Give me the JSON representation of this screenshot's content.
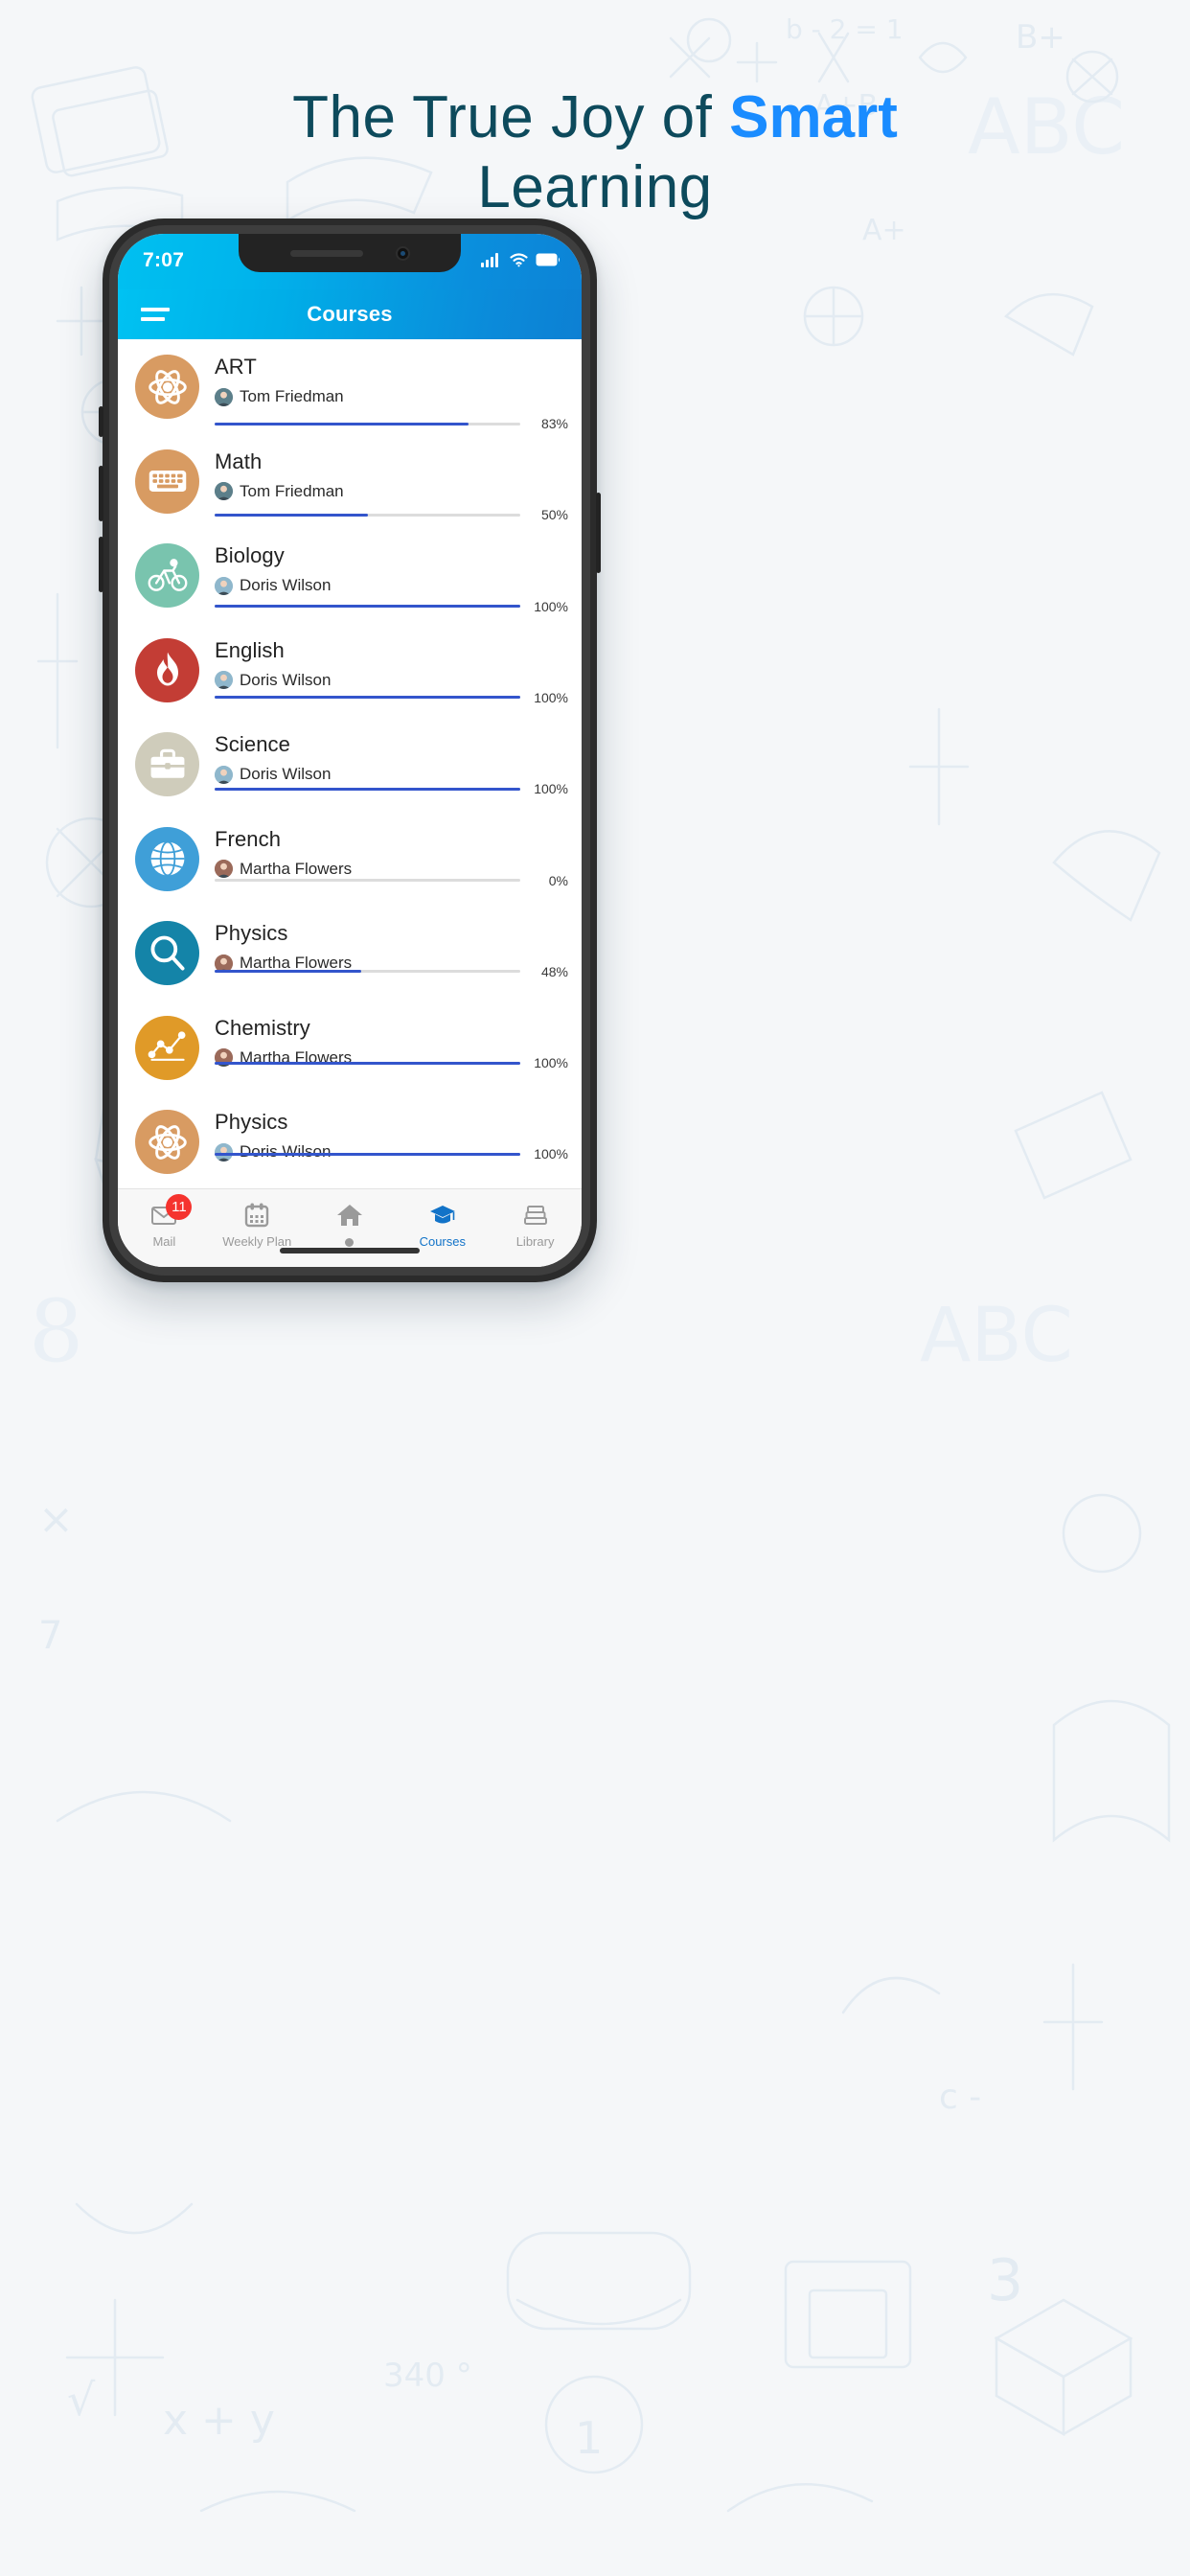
{
  "hero": {
    "line1_pre": "The True Joy of ",
    "line1_accent": "Smart",
    "line2": "Learning",
    "accent_color": "#1a8cff",
    "text_color": "#0d4a5c"
  },
  "status_bar": {
    "time": "7:07",
    "signal_icon": "cellular-signal-icon",
    "wifi_icon": "wifi-icon",
    "battery_icon": "battery-icon"
  },
  "app_bar": {
    "menu_icon": "hamburger-menu-icon",
    "title": "Courses",
    "gradient_from": "#00c2f2",
    "gradient_to": "#0d80d3"
  },
  "courses": [
    {
      "name": "ART",
      "teacher": "Tom Friedman",
      "progress": 83,
      "progress_label": "83%",
      "icon": "atom-icon",
      "avatar_color": "#d89b62",
      "teacher_color": "#5c7f8a"
    },
    {
      "name": "Math",
      "teacher": "Tom Friedman",
      "progress": 50,
      "progress_label": "50%",
      "icon": "keyboard-icon",
      "avatar_color": "#d89b62",
      "teacher_color": "#5c7f8a"
    },
    {
      "name": "Biology",
      "teacher": "Doris Wilson",
      "progress": 100,
      "progress_label": "100%",
      "icon": "bicycle-icon",
      "avatar_color": "#79c4ae",
      "teacher_color": "#8fb7cc"
    },
    {
      "name": "English",
      "teacher": "Doris Wilson",
      "progress": 100,
      "progress_label": "100%",
      "icon": "flame-icon",
      "avatar_color": "#c33d35",
      "teacher_color": "#8fb7cc"
    },
    {
      "name": "Science",
      "teacher": "Doris Wilson",
      "progress": 100,
      "progress_label": "100%",
      "icon": "briefcase-icon",
      "avatar_color": "#cfccbb",
      "teacher_color": "#8fb7cc"
    },
    {
      "name": "French",
      "teacher": "Martha Flowers",
      "progress": 0,
      "progress_label": "0%",
      "icon": "globe-icon",
      "avatar_color": "#3f9fd8",
      "teacher_color": "#9b6a5a"
    },
    {
      "name": "Physics",
      "teacher": "Martha Flowers",
      "progress": 48,
      "progress_label": "48%",
      "icon": "magnifier-icon",
      "avatar_color": "#1484a8",
      "teacher_color": "#9b6a5a"
    },
    {
      "name": "Chemistry",
      "teacher": "Martha Flowers",
      "progress": 100,
      "progress_label": "100%",
      "icon": "line-chart-icon",
      "avatar_color": "#e09a28",
      "teacher_color": "#9b6a5a"
    },
    {
      "name": "Physics",
      "teacher": "Doris Wilson",
      "progress": 100,
      "progress_label": "100%",
      "icon": "atom-icon",
      "avatar_color": "#d89b62",
      "teacher_color": "#8fb7cc"
    }
  ],
  "progress_colors": {
    "fill": "#3355cc",
    "track": "#dcdcdc"
  },
  "bottom_nav": {
    "active_color": "#1273c8",
    "inactive_color": "#9a9a9a",
    "badge_color": "#f5332e",
    "items": [
      {
        "label": "Mail",
        "icon": "envelope-icon",
        "badge": "11",
        "active": false
      },
      {
        "label": "Weekly Plan",
        "icon": "calendar-icon",
        "badge": "",
        "active": false
      },
      {
        "label": "",
        "icon": "home-icon",
        "badge": "",
        "active": false
      },
      {
        "label": "Courses",
        "icon": "graduation-cap-icon",
        "badge": "",
        "active": true
      },
      {
        "label": "Library",
        "icon": "books-icon",
        "badge": "",
        "active": false
      }
    ]
  }
}
